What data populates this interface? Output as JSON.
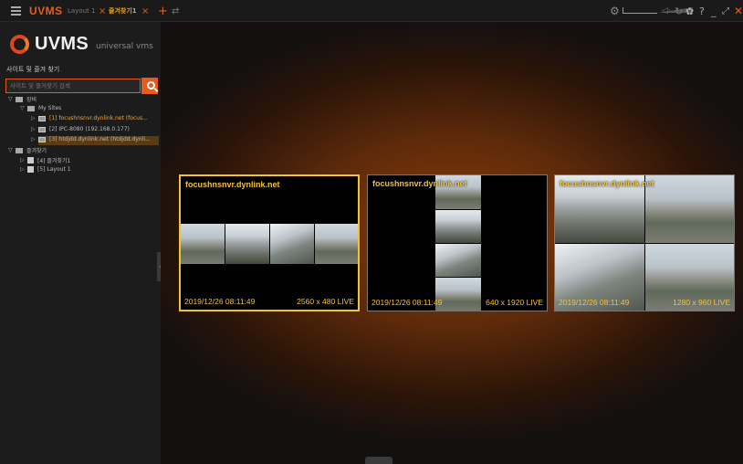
{
  "topbar": {
    "brand": "UVMS",
    "tabs": [
      {
        "label": "Layout 1",
        "close": "×",
        "active": false
      },
      {
        "label": "즐겨찾기1",
        "close": "×",
        "active": true
      }
    ],
    "add_tab": "+",
    "swap": "⇄",
    "controls": {
      "gear": "⚙",
      "volume": "◁·",
      "refresh": "↻",
      "settings": "✿",
      "help": "?",
      "minimize": "_",
      "maximize": "⤢",
      "close": "✕"
    }
  },
  "sidebar": {
    "logo_text": "UVMS",
    "logo_sub": "universal vms",
    "title": "사이트 및 즐겨 찾기",
    "search_placeholder": "사이트 및 즐겨찾기 검색",
    "collapse": "‹",
    "tree": [
      {
        "label": "장비",
        "arrow": "▽",
        "kind": "folder"
      },
      {
        "label": "My Sites",
        "arrow": "▽",
        "kind": "folder"
      },
      {
        "label": "[1] focushnsnvr.dynlink.net (focus...",
        "arrow": "▷",
        "kind": "camera",
        "selected": true
      },
      {
        "label": "[2] IPC-8080 (192.168.0.177)",
        "arrow": "▷",
        "kind": "camera"
      },
      {
        "label": "[3] htdjdd.dynlink.net (htdjdd.dynli...",
        "arrow": "▷",
        "kind": "camera"
      },
      {
        "label": "즐겨찾기",
        "arrow": "▽",
        "kind": "folder"
      },
      {
        "label": "[4] 즐겨찾기1",
        "arrow": "▷",
        "kind": "layout"
      },
      {
        "label": "[5] Layout 1",
        "arrow": "▷",
        "kind": "layout"
      }
    ]
  },
  "tiles": [
    {
      "title": "focushnsnvr.dynlink.net",
      "timestamp": "2019/12/26 08:11:49",
      "resolution": "2560 x 480  LIVE",
      "selected": true
    },
    {
      "title": "focushnsnvr.dynlink.net",
      "timestamp": "2019/12/26 08:11:49",
      "resolution": "640 x 1920  LIVE",
      "selected": false
    },
    {
      "title": "focushnsnvr.dynlink.net",
      "timestamp": "2019/12/26 08:11:49",
      "resolution": "1280 x 960  LIVE",
      "selected": false
    }
  ],
  "colors": {
    "accent": "#e65c1e",
    "overlay_text": "#f2c230",
    "selected_border": "#f2c230"
  }
}
